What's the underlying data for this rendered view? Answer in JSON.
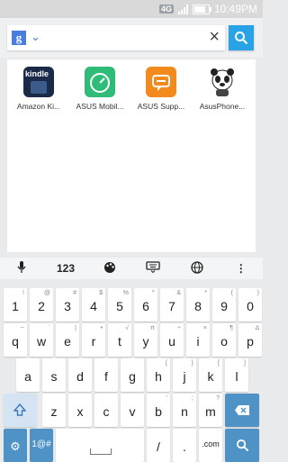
{
  "status": {
    "network": "4G",
    "time": "10:49PM"
  },
  "search": {
    "engine_glyph": "g",
    "query": ""
  },
  "results": [
    {
      "name": "Amazon Ki...",
      "icon": "kindle-icon",
      "icon_text": "kindle",
      "color": "#1a2a47"
    },
    {
      "name": "ASUS Mobil...",
      "icon": "gauge-icon",
      "color": "#2ebc78"
    },
    {
      "name": "ASUS Supp...",
      "icon": "chat-bubble-icon",
      "color": "#f28a1d"
    },
    {
      "name": "AsusPhone...",
      "icon": "panda-icon",
      "color": "#ffffff"
    }
  ],
  "keyboard": {
    "toolbar": {
      "mic": "mic-icon",
      "numbers": "123",
      "theme": "palette-icon",
      "layout": "keyboard-icon",
      "language": "globe-icon",
      "more": "more-icon"
    },
    "row_numbers": [
      {
        "k": "1",
        "s": "!"
      },
      {
        "k": "2",
        "s": "@"
      },
      {
        "k": "3",
        "s": "#"
      },
      {
        "k": "4",
        "s": "$"
      },
      {
        "k": "5",
        "s": "%"
      },
      {
        "k": "6",
        "s": "^"
      },
      {
        "k": "7",
        "s": "&"
      },
      {
        "k": "8",
        "s": "*"
      },
      {
        "k": "9",
        "s": "("
      },
      {
        "k": "0",
        "s": ")"
      }
    ],
    "row_q": [
      {
        "k": "q",
        "s": "~"
      },
      {
        "k": "w",
        "s": "`"
      },
      {
        "k": "e",
        "s": "|"
      },
      {
        "k": "r",
        "s": "•"
      },
      {
        "k": "t",
        "s": "√"
      },
      {
        "k": "y",
        "s": "π"
      },
      {
        "k": "u",
        "s": "÷"
      },
      {
        "k": "i",
        "s": "×"
      },
      {
        "k": "o",
        "s": "¶"
      },
      {
        "k": "p",
        "s": "∆"
      }
    ],
    "row_a": [
      {
        "k": "a",
        "s": ""
      },
      {
        "k": "s",
        "s": ""
      },
      {
        "k": "d",
        "s": ""
      },
      {
        "k": "f",
        "s": ""
      },
      {
        "k": "g",
        "s": ""
      },
      {
        "k": "h",
        "s": "{"
      },
      {
        "k": "j",
        "s": "}"
      },
      {
        "k": "k",
        "s": "["
      },
      {
        "k": "l",
        "s": "]"
      }
    ],
    "row_z": [
      {
        "k": "z",
        "s": ""
      },
      {
        "k": "x",
        "s": ""
      },
      {
        "k": "c",
        "s": ""
      },
      {
        "k": "v",
        "s": ""
      },
      {
        "k": "b",
        "s": "'"
      },
      {
        "k": "n",
        "s": ";"
      },
      {
        "k": "m",
        "s": "?"
      }
    ],
    "sym_key": "1@#",
    "slash_key": "/",
    "dotcom_key": ".com",
    "colors": {
      "action_blue": "#4e92c6",
      "search_blue": "#29a3e6"
    }
  }
}
